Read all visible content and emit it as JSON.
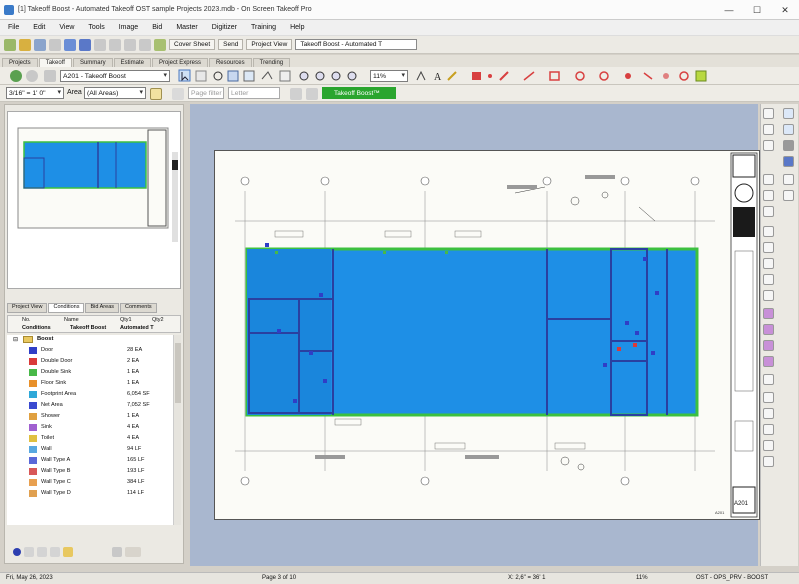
{
  "window": {
    "title": "[1] Takeoff Boost - Automated Takeoff OST sample Projects 2023.mdb - On Screen Takeoff Pro"
  },
  "menu": [
    "File",
    "Edit",
    "View",
    "Tools",
    "Image",
    "Bid",
    "Master",
    "Digitizer",
    "Training",
    "Help"
  ],
  "toolbar1": {
    "cover_sheet_label": "Cover Sheet",
    "send_label": "Send",
    "project_view_label": "Project View",
    "view_select_value": "Takeoff Boost - Automated T"
  },
  "tabs": [
    "Projects",
    "Takeoff",
    "Summary",
    "Estimate",
    "Project Express",
    "Resources",
    "Trending"
  ],
  "toolbar2": {
    "page_select_value": "A201 - Takeoff Boost",
    "zoom_value": "11%"
  },
  "toolbar3": {
    "scale_value": "3/16\" = 1' 0\"",
    "area_label": "Area",
    "area_value": "(All Areas)",
    "page_filter_placeholder": "Page filter",
    "layer_value": "Letter",
    "boost_button_label": "Takeoff Boost™"
  },
  "panel_tabs": [
    "Project View",
    "Conditions",
    "Bid Areas",
    "Comments"
  ],
  "conditions_header": {
    "col_no": "No.",
    "col_name": "Name",
    "col_qty1": "Qty1",
    "col_qty2": "Qty2",
    "sub_conditions": "Conditions",
    "sub_boost": "Takeoff Boost",
    "sub_auto": "Automated T"
  },
  "conditions_folder": "Boost",
  "conditions": [
    {
      "name": "Door",
      "qty": "28 EA",
      "color": "#2f3ec6"
    },
    {
      "name": "Double Door",
      "qty": "2 EA",
      "color": "#d93a3a"
    },
    {
      "name": "Double Sink",
      "qty": "1 EA",
      "color": "#48b848"
    },
    {
      "name": "Floor Sink",
      "qty": "1 EA",
      "color": "#e8902a"
    },
    {
      "name": "Footprint Area",
      "qty": "6,054 SF",
      "color": "#2ea8d8"
    },
    {
      "name": "Net Area",
      "qty": "7,052 SF",
      "color": "#3a4ad0"
    },
    {
      "name": "Shower",
      "qty": "1 EA",
      "color": "#e0a040"
    },
    {
      "name": "Sink",
      "qty": "4 EA",
      "color": "#a060d0"
    },
    {
      "name": "Toilet",
      "qty": "4 EA",
      "color": "#e0c040"
    },
    {
      "name": "Wall",
      "qty": "94 LF",
      "color": "#58a8e0"
    },
    {
      "name": "Wall Type A",
      "qty": "165 LF",
      "color": "#5a68d8"
    },
    {
      "name": "Wall Type B",
      "qty": "193 LF",
      "color": "#d85858"
    },
    {
      "name": "Wall Type C",
      "qty": "384 LF",
      "color": "#e8a050"
    },
    {
      "name": "Wall Type D",
      "qty": "114 LF",
      "color": "#e0a050"
    }
  ],
  "status": {
    "date": "Fri, May 26, 2023",
    "page": "Page 3 of 10",
    "coords": "X: 2,6\" = 36' 1",
    "zoom": "11%",
    "mode": "OST - OPS_PRV - BOOST"
  },
  "sheet": {
    "number": "A201"
  },
  "colors": {
    "takeoff_fill": "#1e8fe6",
    "wall_line": "#2a40a0",
    "boundary_green": "#3cc040",
    "canvas_bg": "#a9b7cf",
    "boost_button": "#2aa52e"
  }
}
